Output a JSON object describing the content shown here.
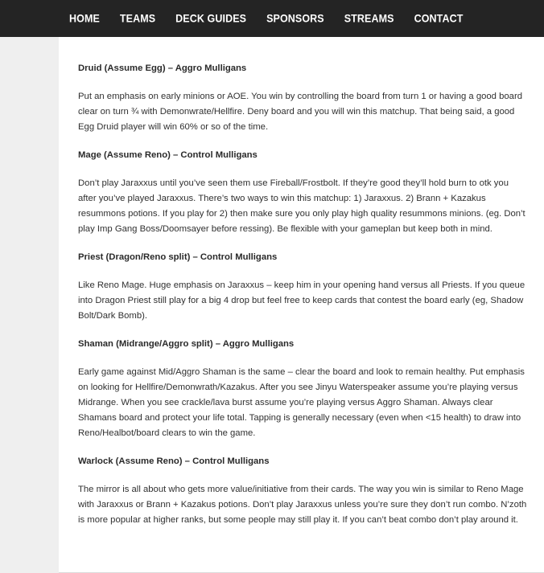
{
  "nav": {
    "items": [
      {
        "label": "HOME"
      },
      {
        "label": "TEAMS"
      },
      {
        "label": "DECK GUIDES"
      },
      {
        "label": "SPONSORS"
      },
      {
        "label": "STREAMS"
      },
      {
        "label": "CONTACT"
      }
    ]
  },
  "article": {
    "sections": [
      {
        "heading": "Druid (Assume Egg) – Aggro Mulligans",
        "body": "Put an emphasis on early minions or AOE. You win by controlling the board from turn 1 or having a good board clear on turn ¾ with Demonwrate/Hellfire. Deny board and you will win this matchup. That being said, a good Egg Druid player will win 60% or so of the time."
      },
      {
        "heading": "Mage (Assume Reno) – Control Mulligans",
        "body": "Don’t play Jaraxxus until you’ve seen them use Fireball/Frostbolt. If they’re good they’ll hold burn to otk you after you’ve played Jaraxxus. There’s two ways to win this matchup: 1) Jaraxxus. 2) Brann + Kazakus resummons potions. If you play for 2) then make sure you only play high quality resummons minions. (eg. Don’t play Imp Gang Boss/Doomsayer before ressing). Be flexible with your gameplan but keep both in mind."
      },
      {
        "heading": "Priest (Dragon/Reno split) – Control Mulligans",
        "body": "Like Reno Mage. Huge emphasis on Jaraxxus – keep him in your opening hand versus all Priests. If you queue into Dragon Priest still play for a big 4 drop but feel free to keep cards that contest the board early (eg, Shadow Bolt/Dark Bomb)."
      },
      {
        "heading": "Shaman (Midrange/Aggro split) –  Aggro Mulligans",
        "body": "Early game against Mid/Aggro Shaman is the same – clear the board and look to remain healthy. Put emphasis on looking for Hellfire/Demonwrath/Kazakus. After you see Jinyu Waterspeaker assume you’re playing versus Midrange. When you see crackle/lava burst assume you’re playing versus Aggro Shaman. Always clear Shamans board and protect your life total. Tapping is generally necessary (even when <15 health) to draw into Reno/Healbot/board clears to win the game."
      },
      {
        "heading": "Warlock (Assume Reno) – Control Mulligans",
        "body": "The mirror is all about who gets more value/initiative from their cards. The way you win is similar to Reno Mage with Jaraxxus or Brann + Kazakus potions. Don’t play Jaraxxus unless you’re sure they don’t run combo. N’zoth is more popular at higher ranks, but some people may still play it. If you can’t beat combo don’t play around it."
      }
    ]
  }
}
